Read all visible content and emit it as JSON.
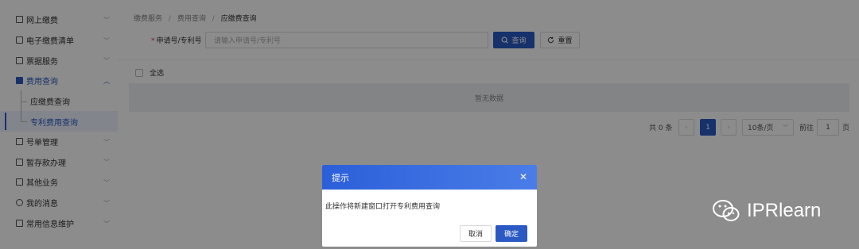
{
  "sidebar": {
    "items": [
      {
        "label": "网上缴费"
      },
      {
        "label": "电子缴费清单"
      },
      {
        "label": "票据服务"
      },
      {
        "label": "费用查询"
      },
      {
        "label": "号单管理"
      },
      {
        "label": "暂存款办理"
      },
      {
        "label": "其他业务"
      },
      {
        "label": "我的消息"
      },
      {
        "label": "常用信息维护"
      }
    ],
    "sub_items": [
      {
        "label": "应缴费查询"
      },
      {
        "label": "专利费用查询"
      }
    ]
  },
  "breadcrumb": {
    "b1": "缴费服务",
    "b2": "费用查询",
    "b3": "应缴费查询",
    "sep": "/"
  },
  "form": {
    "req_mark": "*",
    "label": "申请号/专利号",
    "placeholder": "请输入申请号/专利号",
    "query_label": "查询",
    "reset_label": "重置"
  },
  "table": {
    "select_all": "全选",
    "empty": "暂无数据"
  },
  "pagination": {
    "total": "共 0 条",
    "current_page": "1",
    "page_size": "10条/页",
    "goto_label": "前往",
    "goto_value": "1",
    "page_unit": "页"
  },
  "dialog": {
    "title": "提示",
    "message": "此操作将新建窗口打开专利费用查询",
    "cancel_label": "取消",
    "ok_label": "确定"
  },
  "watermark": {
    "text": "IPRlearn",
    "icon": "wechat-icon"
  },
  "colors": {
    "accent": "#2b59c3"
  }
}
